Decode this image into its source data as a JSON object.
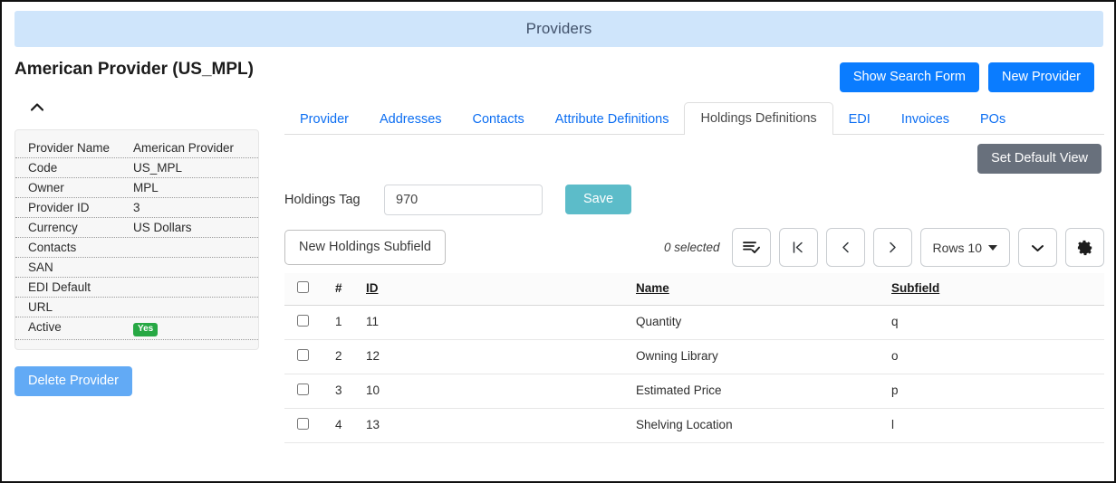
{
  "banner": {
    "title": "Providers"
  },
  "record": {
    "heading": "American Provider (US_MPL)"
  },
  "top_actions": {
    "show_search_form": "Show Search Form",
    "new_provider": "New Provider"
  },
  "sidebar": {
    "collapse_icon": "chevron-up-icon",
    "details": [
      {
        "label": "Provider Name",
        "value": "American Provider"
      },
      {
        "label": "Code",
        "value": "US_MPL"
      },
      {
        "label": "Owner",
        "value": "MPL"
      },
      {
        "label": "Provider ID",
        "value": "3"
      },
      {
        "label": "Currency",
        "value": "US Dollars"
      },
      {
        "label": "Contacts",
        "value": ""
      },
      {
        "label": "SAN",
        "value": ""
      },
      {
        "label": "EDI Default",
        "value": ""
      },
      {
        "label": "URL",
        "value": ""
      },
      {
        "label": "Active",
        "value": "",
        "badge": "Yes"
      }
    ],
    "delete_button": "Delete Provider"
  },
  "tabs": [
    {
      "label": "Provider",
      "active": false
    },
    {
      "label": "Addresses",
      "active": false
    },
    {
      "label": "Contacts",
      "active": false
    },
    {
      "label": "Attribute Definitions",
      "active": false
    },
    {
      "label": "Holdings Definitions",
      "active": true
    },
    {
      "label": "EDI",
      "active": false
    },
    {
      "label": "Invoices",
      "active": false
    },
    {
      "label": "POs",
      "active": false
    }
  ],
  "panel": {
    "set_default_view": "Set Default View",
    "holdings_tag_label": "Holdings Tag",
    "holdings_tag_value": "970",
    "holdings_tag_placeholder": "",
    "save_label": "Save",
    "new_subfield_label": "New Holdings Subfield",
    "selected_count": "0 selected",
    "rows_label": "Rows 10",
    "icons": {
      "select_actions": "list-check-icon",
      "first_page": "|<",
      "prev_page": "‹",
      "next_page": "›",
      "more": "chevron-down-icon",
      "settings": "gear-icon"
    }
  },
  "table": {
    "columns": [
      "#",
      "ID",
      "Name",
      "Subfield"
    ],
    "rows": [
      {
        "num": "1",
        "id": "11",
        "name": "Quantity",
        "subfield": "q"
      },
      {
        "num": "2",
        "id": "12",
        "name": "Owning Library",
        "subfield": "o"
      },
      {
        "num": "3",
        "id": "10",
        "name": "Estimated Price",
        "subfield": "p"
      },
      {
        "num": "4",
        "id": "13",
        "name": "Shelving Location",
        "subfield": "l"
      }
    ]
  },
  "colors": {
    "banner_bg": "#cfe5fb",
    "primary": "#0a7cff",
    "secondary": "#68707c",
    "teal": "#5cbcc9",
    "soft_blue": "#62aaf5",
    "badge_green": "#27a844"
  }
}
